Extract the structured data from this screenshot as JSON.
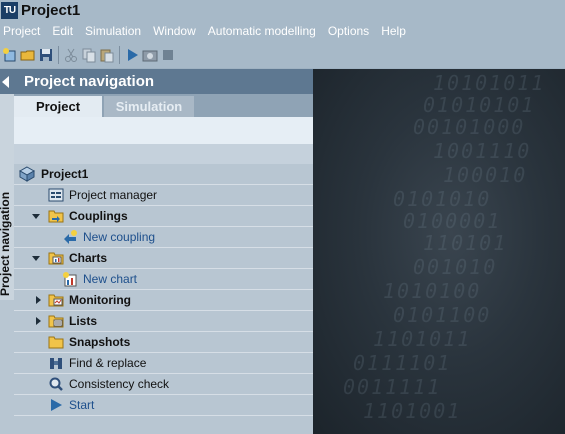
{
  "window": {
    "title": "Project1",
    "logo_text": "TU"
  },
  "menu": [
    "Project",
    "Edit",
    "Simulation",
    "Window",
    "Automatic modelling",
    "Options",
    "Help"
  ],
  "toolbar": {
    "icons": [
      "new-project-icon",
      "open-folder-icon",
      "save-icon",
      "cut-icon",
      "copy-icon",
      "paste-icon",
      "start-simulation-icon",
      "snapshot-camera-icon",
      "stop-icon"
    ]
  },
  "nav": {
    "title": "Project navigation",
    "side_tab_label": "Project navigation",
    "tabs": [
      {
        "label": "Project",
        "active": true
      },
      {
        "label": "Simulation",
        "active": false
      }
    ]
  },
  "tree": {
    "root": {
      "label": "Project1",
      "icon": "project-root-icon"
    },
    "items": [
      {
        "label": "Project manager",
        "icon": "project-manager-icon",
        "expander": "none",
        "style": "normal",
        "level": 1
      },
      {
        "label": "Couplings",
        "icon": "couplings-folder-icon",
        "expander": "expanded",
        "style": "bold",
        "level": 1
      },
      {
        "label": "New coupling",
        "icon": "new-coupling-icon",
        "expander": "none",
        "style": "link",
        "level": 2
      },
      {
        "label": "Charts",
        "icon": "charts-folder-icon",
        "expander": "expanded",
        "style": "bold",
        "level": 1
      },
      {
        "label": "New chart",
        "icon": "new-chart-icon",
        "expander": "none",
        "style": "link",
        "level": 2
      },
      {
        "label": "Monitoring",
        "icon": "monitoring-folder-icon",
        "expander": "collapsed",
        "style": "bold",
        "level": 1
      },
      {
        "label": "Lists",
        "icon": "lists-folder-icon",
        "expander": "collapsed",
        "style": "bold",
        "level": 1
      },
      {
        "label": "Snapshots",
        "icon": "snapshots-folder-icon",
        "expander": "none",
        "style": "bold",
        "level": 1
      },
      {
        "label": "Find & replace",
        "icon": "find-replace-icon",
        "expander": "none",
        "style": "normal",
        "level": 1
      },
      {
        "label": "Consistency check",
        "icon": "consistency-check-icon",
        "expander": "none",
        "style": "normal",
        "level": 1
      },
      {
        "label": "Start",
        "icon": "start-play-icon",
        "expander": "none",
        "style": "link",
        "level": 1
      }
    ]
  },
  "workspace": {
    "background_text": [
      "10101011",
      "01010101",
      "00101000",
      "1001110",
      "100010",
      "0101010",
      "0100001",
      "110101",
      "001010",
      "1010100",
      "0101100",
      "1101011",
      "0111101",
      "0011111",
      "1101001"
    ]
  },
  "colors": {
    "accent": "#1b3e66",
    "header": "#5e7891",
    "link": "#1d4f8c",
    "play": "#2a6aa8"
  }
}
